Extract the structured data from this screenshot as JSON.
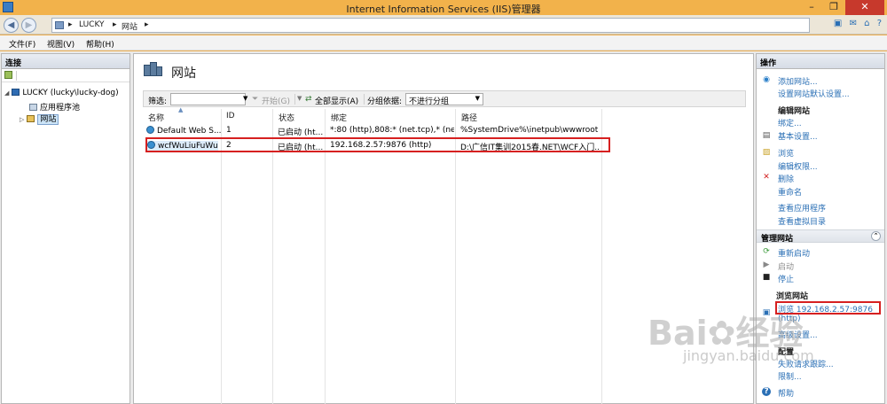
{
  "window": {
    "title": "Internet Information Services (IIS)管理器",
    "min": "–",
    "max": "❐",
    "close": "✕"
  },
  "address": {
    "back": "◀",
    "forward": "▶",
    "crumb_sep": "▸",
    "crumbs": [
      "LUCKY",
      "网站"
    ]
  },
  "menu": [
    "文件(F)",
    "视图(V)",
    "帮助(H)"
  ],
  "connections": {
    "title": "连接",
    "tree": [
      {
        "label": "LUCKY (lucky\\lucky-dog)",
        "expander": "◢"
      },
      {
        "label": "应用程序池",
        "expander": ""
      },
      {
        "label": "网站",
        "expander": "▷"
      }
    ]
  },
  "center": {
    "title": "网站",
    "filter": {
      "label": "筛选:",
      "start": "开始(G)",
      "show_all": "全部显示(A)",
      "group_label": "分组依据:",
      "group_value": "不进行分组"
    },
    "columns": [
      "名称",
      "ID",
      "状态",
      "绑定",
      "路径"
    ],
    "rows": [
      [
        "Default Web S...",
        "1",
        "已启动 (ht...",
        "*:80 (http),808:* (net.tcp),* (net....",
        "%SystemDrive%\\inetpub\\wwwroot"
      ],
      [
        "wcfWuLiuFuWu",
        "2",
        "已启动 (ht...",
        "192.168.2.57:9876 (http)",
        "D:\\广信IT集训2015春.NET\\WCF入门..."
      ]
    ]
  },
  "actions": {
    "title": "操作",
    "add_site": "添加网站...",
    "set_defaults": "设置网站默认设置...",
    "edit_site_head": "编辑网站",
    "bindings": "绑定...",
    "basic_settings": "基本设置...",
    "explore": "浏览",
    "edit_permissions": "编辑权限...",
    "delete": "删除",
    "rename": "重命名",
    "view_apps": "查看应用程序",
    "view_vdirs": "查看虚拟目录",
    "manage_head": "管理网站",
    "restart": "重新启动",
    "start": "启动",
    "stop": "停止",
    "browse_head": "浏览网站",
    "browse_link": "浏览 192.168.2.57:9876",
    "browse_proto": "(http)",
    "advanced": "高级设置...",
    "config_head": "配置",
    "failed_tracing": "失败请求跟踪...",
    "limits": "限制...",
    "help": "帮助",
    "collapse": "⌃"
  },
  "watermark": {
    "text": "Bai✿经验",
    "sub": "jingyan.baidu.com"
  }
}
